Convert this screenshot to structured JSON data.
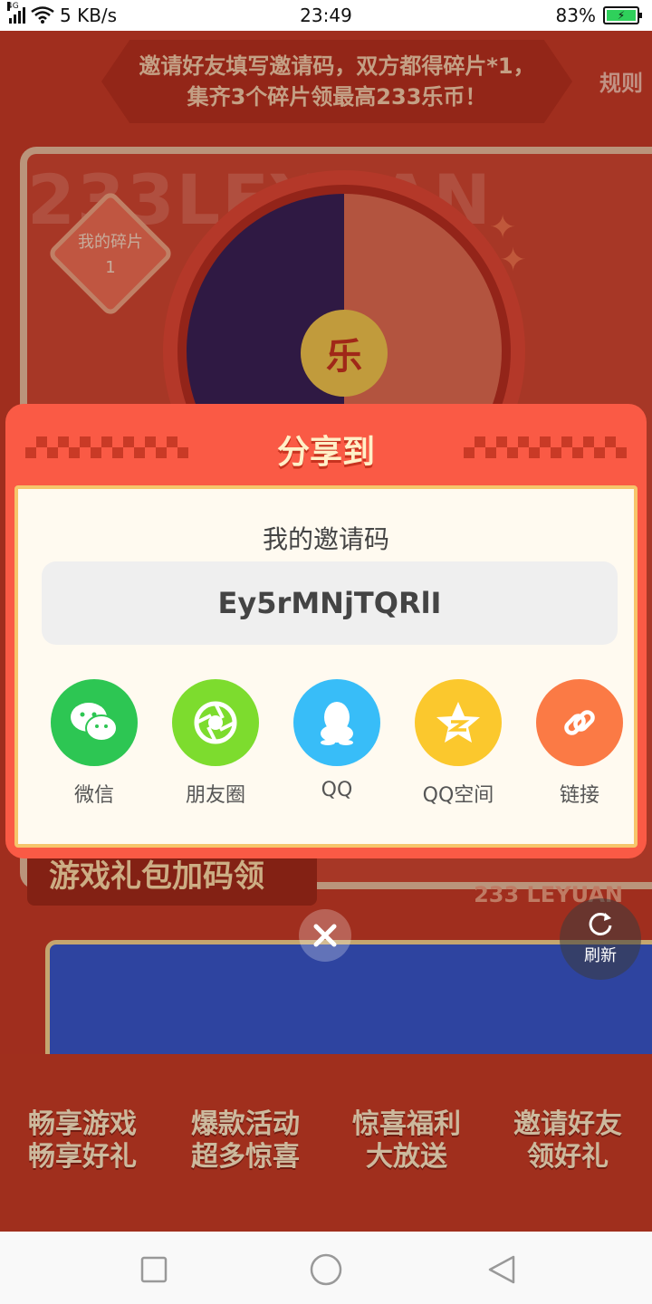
{
  "status_bar": {
    "network_tag": "4G",
    "speed": "5 KB/s",
    "time": "23:49",
    "battery": "83%"
  },
  "background": {
    "banner_line1": "邀请好友填写邀请码，双方都得碎片*1，",
    "banner_line2": "集齐3个碎片领最高233乐币！",
    "rules": "规则",
    "watermark": "233LEYUAN",
    "fragment_label": "我的碎片",
    "fragment_count": "1",
    "wheel_hub": "乐",
    "gift_title": "游戏礼包加码领",
    "leyuan_label": "233 LEYUAN",
    "features": [
      {
        "line1": "畅享游戏",
        "line2": "畅享好礼"
      },
      {
        "line1": "爆款活动",
        "line2": "超多惊喜"
      },
      {
        "line1": "惊喜福利",
        "line2": "大放送"
      },
      {
        "line1": "邀请好友",
        "line2": "领好礼"
      }
    ]
  },
  "dialog": {
    "title": "分享到",
    "heading": "我的邀请码",
    "invite_code": "Ey5rMNjTQRlI",
    "targets": [
      {
        "label": "微信",
        "icon": "wechat-icon",
        "color": "#2dc653"
      },
      {
        "label": "朋友圈",
        "icon": "moments-icon",
        "color": "#7ddc2e"
      },
      {
        "label": "QQ",
        "icon": "qq-icon",
        "color": "#38bdf8"
      },
      {
        "label": "QQ空间",
        "icon": "qzone-icon",
        "color": "#fbc82d"
      },
      {
        "label": "链接",
        "icon": "link-icon",
        "color": "#fb7a45"
      }
    ]
  },
  "refresh_label": "刷新",
  "colors": {
    "dialog_bg": "#fa5a45",
    "card_bg": "#fffaf0",
    "page_bg": "#c93a26"
  }
}
